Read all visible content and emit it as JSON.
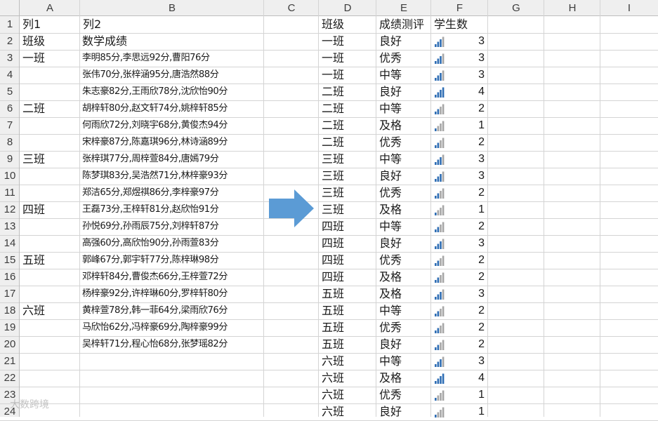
{
  "sheet": {
    "columns": [
      "A",
      "B",
      "C",
      "D",
      "E",
      "F",
      "G",
      "H",
      "I"
    ],
    "rows": [
      "1",
      "2",
      "3",
      "4",
      "5",
      "6",
      "7",
      "8",
      "9",
      "10",
      "11",
      "12",
      "13",
      "14",
      "15",
      "16",
      "17",
      "18",
      "19",
      "20",
      "21",
      "22",
      "23",
      "24"
    ]
  },
  "left_table": {
    "headers": [
      "列1",
      "列2"
    ],
    "rows": [
      {
        "class": "班级",
        "scores": "数学成绩"
      },
      {
        "class": "一班",
        "scores": "李明85分,李思远92分,曹阳76分"
      },
      {
        "class": "",
        "scores": "张伟70分,张梓涵95分,唐浩然88分"
      },
      {
        "class": "",
        "scores": "朱志豪82分,王雨欣78分,沈欣怡90分"
      },
      {
        "class": "二班",
        "scores": "胡梓轩80分,赵文轩74分,姚梓轩85分"
      },
      {
        "class": "",
        "scores": "何雨欣72分,刘晓宇68分,黄俊杰94分"
      },
      {
        "class": "",
        "scores": "宋梓豪87分,陈嘉琪96分,林诗涵89分"
      },
      {
        "class": "三班",
        "scores": "张梓琪77分,周梓萱84分,唐嫣79分"
      },
      {
        "class": "",
        "scores": "陈梦琪83分,吴浩然71分,林梓豪93分"
      },
      {
        "class": "",
        "scores": "郑洁65分,郑煜祺86分,李梓豪97分"
      },
      {
        "class": "四班",
        "scores": "王磊73分,王梓轩81分,赵欣怡91分"
      },
      {
        "class": "",
        "scores": "孙悦69分,孙雨辰75分,刘梓轩87分"
      },
      {
        "class": "",
        "scores": "高强60分,高欣怡90分,孙雨萱83分"
      },
      {
        "class": "五班",
        "scores": "郭峰67分,郭宇轩77分,陈梓琳98分"
      },
      {
        "class": "",
        "scores": "邓梓轩84分,曹俊杰66分,王梓萱72分"
      },
      {
        "class": "",
        "scores": "杨梓豪92分,许梓琳60分,罗梓轩80分"
      },
      {
        "class": "六班",
        "scores": "黄梓萱78分,韩一菲64分,梁雨欣76分"
      },
      {
        "class": "",
        "scores": "马欣怡62分,冯梓豪69分,陶梓豪99分"
      },
      {
        "class": "",
        "scores": "吴梓轩71分,程心怡68分,张梦瑶82分"
      }
    ]
  },
  "right_table": {
    "headers": [
      "班级",
      "成绩测评",
      "学生数"
    ],
    "rows": [
      {
        "class": "一班",
        "grade": "良好",
        "count": 3
      },
      {
        "class": "一班",
        "grade": "优秀",
        "count": 3
      },
      {
        "class": "一班",
        "grade": "中等",
        "count": 3
      },
      {
        "class": "二班",
        "grade": "良好",
        "count": 4
      },
      {
        "class": "二班",
        "grade": "中等",
        "count": 2
      },
      {
        "class": "二班",
        "grade": "及格",
        "count": 1
      },
      {
        "class": "二班",
        "grade": "优秀",
        "count": 2
      },
      {
        "class": "三班",
        "grade": "中等",
        "count": 3
      },
      {
        "class": "三班",
        "grade": "良好",
        "count": 3
      },
      {
        "class": "三班",
        "grade": "优秀",
        "count": 2
      },
      {
        "class": "三班",
        "grade": "及格",
        "count": 1
      },
      {
        "class": "四班",
        "grade": "中等",
        "count": 2
      },
      {
        "class": "四班",
        "grade": "良好",
        "count": 3
      },
      {
        "class": "四班",
        "grade": "优秀",
        "count": 2
      },
      {
        "class": "四班",
        "grade": "及格",
        "count": 2
      },
      {
        "class": "五班",
        "grade": "及格",
        "count": 3
      },
      {
        "class": "五班",
        "grade": "中等",
        "count": 2
      },
      {
        "class": "五班",
        "grade": "优秀",
        "count": 2
      },
      {
        "class": "五班",
        "grade": "良好",
        "count": 2
      },
      {
        "class": "六班",
        "grade": "中等",
        "count": 3
      },
      {
        "class": "六班",
        "grade": "及格",
        "count": 4
      },
      {
        "class": "六班",
        "grade": "优秀",
        "count": 1
      },
      {
        "class": "六班",
        "grade": "良好",
        "count": 1
      }
    ],
    "icon_set": {
      "name": "signal-bars-icon",
      "max": 4,
      "active_color": "#2e6db4",
      "inactive_color": "#a6a6a6"
    }
  },
  "decor": {
    "arrow_color": "#5b9bd5",
    "header_bg": "#efefef",
    "grid_color": "#d4d4d4",
    "header_line_color": "#bdbdbd"
  },
  "watermark": "大数跨境"
}
